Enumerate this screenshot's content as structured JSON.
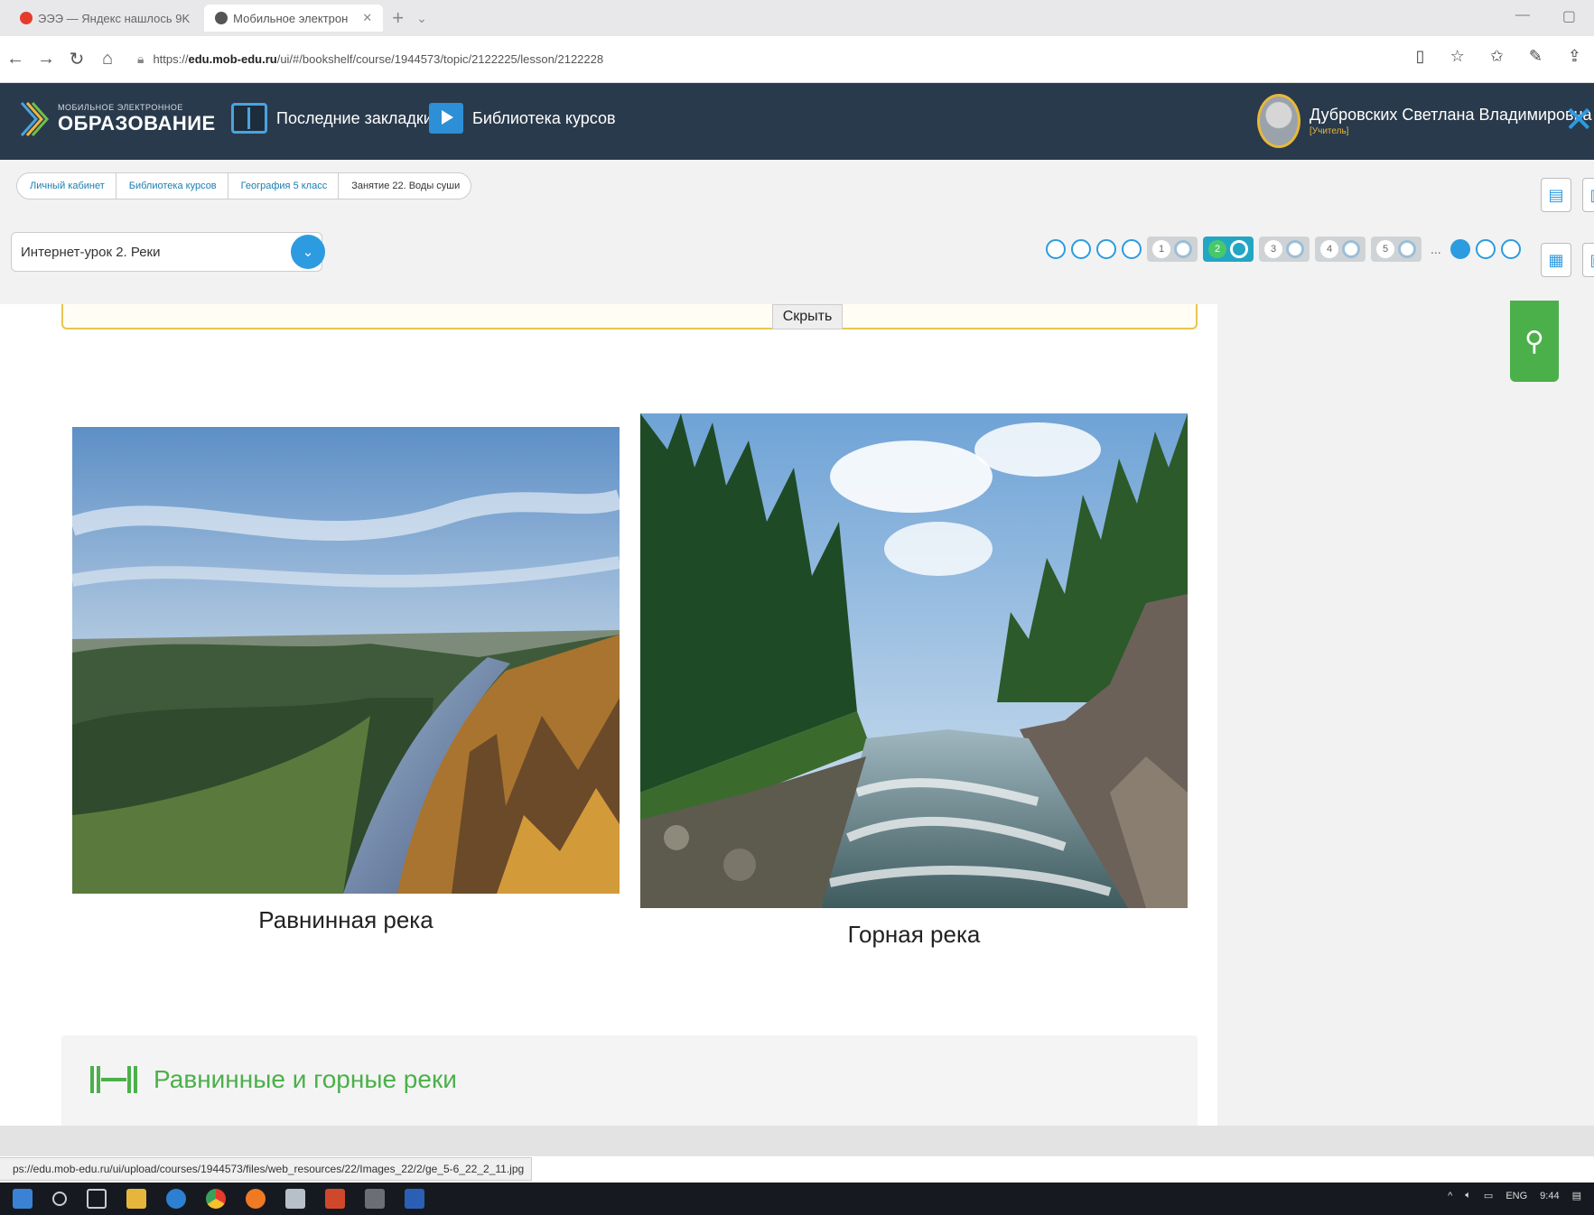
{
  "browser": {
    "tabs": [
      {
        "label": "ЭЭЭ — Яндекс нашлось 9K"
      },
      {
        "label": "Мобильное электрон"
      }
    ],
    "new_tab": "+",
    "url_prefix": "https://",
    "url_host": "edu.mob-edu.ru",
    "url_path": "/ui/#/bookshelf/course/1944573/topic/2122225/lesson/2122228"
  },
  "header": {
    "logo_small": "МОБИЛЬНОЕ ЭЛЕКТРОННОЕ",
    "logo_big": "ОБРАЗОВАНИЕ",
    "bookmarks_label": "Последние закладки",
    "library_label": "Библиотека курсов",
    "user_name": "Дубровских Светлана Владимировна",
    "user_role": "[Учитель]"
  },
  "breadcrumbs": [
    "Личный кабинет",
    "Библиотека курсов",
    "География 5 класс",
    "Занятие 22. Воды суши"
  ],
  "lesson_select": {
    "value": "Интернет-урок 2. Реки"
  },
  "pager": {
    "pages": [
      "1",
      "2",
      "3",
      "4",
      "5"
    ],
    "active_page": "2",
    "ellipsis": "..."
  },
  "content": {
    "hide_button": "Скрыть",
    "caption_plain": "Равнинная река",
    "caption_mountain": "Горная река",
    "section_title": "Равнинные и горные реки"
  },
  "status_url": "ps://edu.mob-edu.ru/ui/upload/courses/1944573/files/web_resources/22/Images_22/2/ge_5-6_22_2_11.jpg",
  "tray": {
    "lang": "ENG",
    "time": "9:44"
  },
  "colors": {
    "header_bg": "#293a4c",
    "accent": "#2d9be0",
    "green": "#4bb04a",
    "yellow_border": "#e8c64e"
  }
}
